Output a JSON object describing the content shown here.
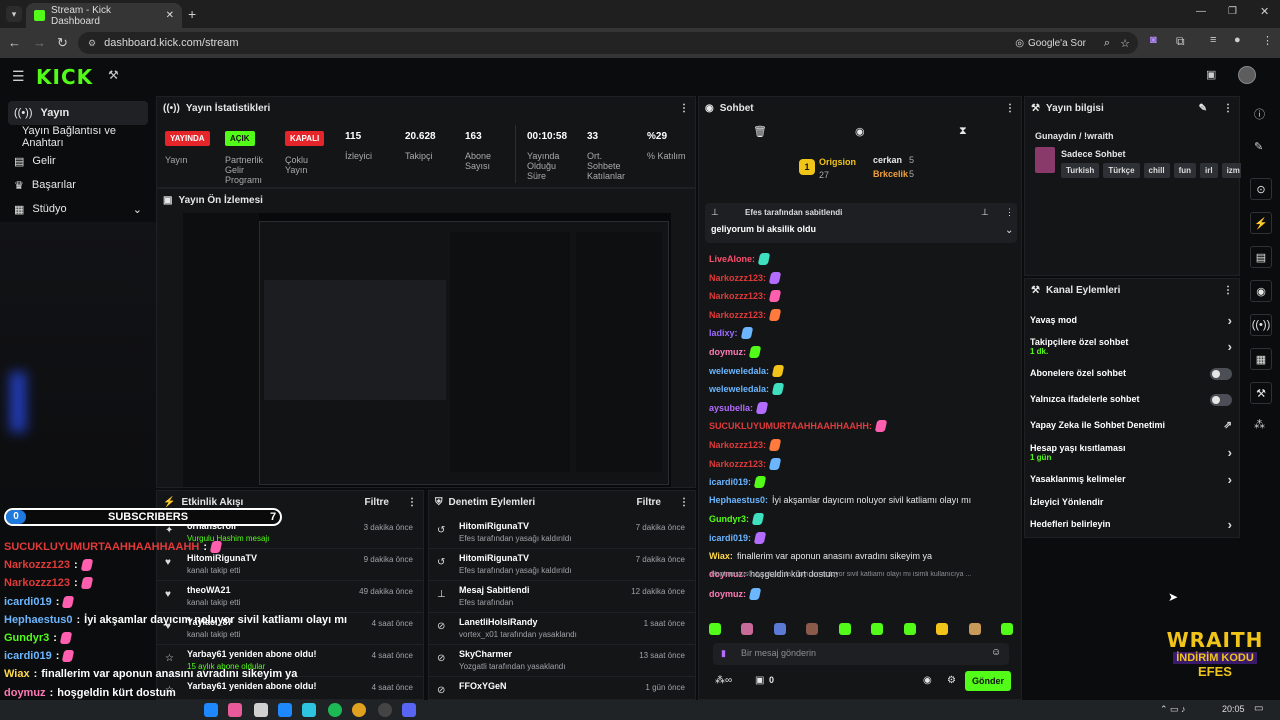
{
  "browser": {
    "tab_title": "Stream - Kick Dashboard",
    "url": "dashboard.kick.com/stream",
    "google_label": "Google'a Sor"
  },
  "sidebar": {
    "items": [
      {
        "label": "Yayın",
        "icon": "broadcast-icon"
      },
      {
        "label": "Yayın Bağlantısı ve Anahtarı",
        "icon": ""
      },
      {
        "label": "Gelir",
        "icon": "dollar-icon"
      },
      {
        "label": "Başarılar",
        "icon": "trophy-icon"
      },
      {
        "label": "Stüdyo",
        "icon": "studio-icon"
      }
    ]
  },
  "stats": {
    "title": "Yayın İstatistikleri",
    "items": [
      {
        "value": "YAYINDA",
        "label": "Yayın"
      },
      {
        "value": "AÇIK",
        "label": "Partnerlik Gelir Programı"
      },
      {
        "value": "KAPALI",
        "label": "Çoklu Yayın"
      },
      {
        "value": "115",
        "label": "İzleyici"
      },
      {
        "value": "20.628",
        "label": "Takipçi"
      },
      {
        "value": "163",
        "label": "Abone Sayısı"
      },
      {
        "value": "00:10:58",
        "label": "Yayında Olduğu Süre"
      },
      {
        "value": "33",
        "label": "Ort. Sohbete Katılanlar"
      },
      {
        "value": "%29",
        "label": "% Katılım"
      }
    ]
  },
  "preview": {
    "title": "Yayın Ön İzlemesi"
  },
  "activity": {
    "title": "Etkinlik Akışı",
    "filter": "Filtre",
    "rows": [
      {
        "title": "orhanscroll",
        "sub": "Vurgulu Hashim mesajı",
        "time": "3 dakika önce"
      },
      {
        "title": "HitomiRigunaTV",
        "sub": "kanalı takip etti",
        "time": "9 dakika önce"
      },
      {
        "title": "theoWA21",
        "sub": "kanalı takip etti",
        "time": "49 dakika önce"
      },
      {
        "title": "Yaylaci_87",
        "sub": "kanalı takip etti",
        "time": "4 saat önce"
      },
      {
        "title": "Yarbay61 yeniden abone oldu!",
        "sub": "15 aylık abone oldular",
        "time": "4 saat önce"
      },
      {
        "title": "Yarbay61 yeniden abone oldu!",
        "sub": "",
        "time": "4 saat önce"
      }
    ]
  },
  "moderation": {
    "title": "Denetim Eylemleri",
    "filter": "Filtre",
    "rows": [
      {
        "title": "HitomiRigunaTV",
        "sub": "Efes tarafından yasağı kaldırıldı",
        "time": "7 dakika önce"
      },
      {
        "title": "HitomiRigunaTV",
        "sub": "Efes tarafından yasağı kaldırıldı",
        "time": "7 dakika önce"
      },
      {
        "title": "Mesaj Sabitlendi",
        "sub": "Efes tarafından",
        "time": "12 dakika önce"
      },
      {
        "title": "LanetliHolsiRandy",
        "sub": "vortex_x01 tarafından yasaklandı",
        "time": "1 saat önce"
      },
      {
        "title": "SkyCharmer",
        "sub": "Yozgatli tarafından yasaklandı",
        "time": "13 saat önce"
      },
      {
        "title": "FFOxYGeN",
        "sub": "",
        "time": "1 gün önce"
      }
    ]
  },
  "chat": {
    "title": "Sohbet",
    "top": {
      "first": "Origsion",
      "first_count": "27",
      "second": "cerkan",
      "second_count": "5",
      "third": "Brkcelik",
      "third_count": "5"
    },
    "pinned_by": "Efes tarafından sabitlendi",
    "pinned_msg": "geliyorum bi aksilik oldu",
    "messages": [
      {
        "user": "LiveAlone:",
        "color": "#ff4d6d",
        "text": ""
      },
      {
        "user": "Narkozzz123:",
        "color": "#e03a3a",
        "text": ""
      },
      {
        "user": "Narkozzz123:",
        "color": "#e03a3a",
        "text": ""
      },
      {
        "user": "Narkozzz123:",
        "color": "#e03a3a",
        "text": ""
      },
      {
        "user": "ladixy:",
        "color": "#9b6bff",
        "text": ""
      },
      {
        "user": "doymuz:",
        "color": "#ff7ab6",
        "text": ""
      },
      {
        "user": "weleweledala:",
        "color": "#6bb6ff",
        "text": ""
      },
      {
        "user": "weleweledala:",
        "color": "#6bb6ff",
        "text": ""
      },
      {
        "user": "aysubella:",
        "color": "#b46bff",
        "text": ""
      },
      {
        "user": "SUCUKLUYUMURTAAHHAAHHAAHH:",
        "color": "#e03a3a",
        "text": ""
      },
      {
        "user": "Narkozzz123:",
        "color": "#e03a3a",
        "text": ""
      },
      {
        "user": "Narkozzz123:",
        "color": "#e03a3a",
        "text": ""
      },
      {
        "user": "icardi019:",
        "color": "#6bb6ff",
        "text": ""
      },
      {
        "user": "Hephaestus0:",
        "color": "#6bb6ff",
        "text": "İyi akşamlar dayıcım noluyor sivil katliamı olayı mı"
      },
      {
        "user": "Gundyr3:",
        "color": "#53fc18",
        "text": ""
      },
      {
        "user": "icardi019:",
        "color": "#6bb6ff",
        "text": ""
      },
      {
        "user": "Wiax:",
        "color": "#ffd84d",
        "text": "finallerim var aponun anasını avradını sikeyim ya"
      },
      {
        "user": "doymuz:",
        "color": "#ff7ab6",
        "text": "hoşgeldin kürt dostum"
      },
      {
        "user": "doymuz:",
        "color": "#ff7ab6",
        "text": ""
      }
    ],
    "reply_preview": "Hephaestus0: İyi akşamlar dayıcım noluyor sivil katliamı olayı mı isimli kullanıcıya ...",
    "input_placeholder": "Bir mesaj gönderin",
    "send_label": "Gönder",
    "points": "0"
  },
  "stream_info": {
    "title": "Yayın bilgisi",
    "stream_title": "Gunaydın / !wraith",
    "category": "Sadece Sohbet",
    "tags": [
      "Turkish",
      "Türkçe",
      "chill",
      "fun",
      "irl",
      "izm"
    ]
  },
  "channel_actions": {
    "title": "Kanal Eylemleri",
    "items": [
      {
        "label": "Yavaş mod",
        "sub": "",
        "control": "chevron"
      },
      {
        "label": "Takipçilere özel sohbet",
        "sub": "1 dk.",
        "control": "chevron"
      },
      {
        "label": "Abonelere özel sohbet",
        "sub": "",
        "control": "toggle"
      },
      {
        "label": "Yalnızca ifadelerle sohbet",
        "sub": "",
        "control": "toggle"
      },
      {
        "label": "Yapay Zeka ile Sohbet Denetimi",
        "sub": "",
        "control": "external"
      },
      {
        "label": "Hesap yaşı kısıtlaması",
        "sub": "1 gün",
        "control": "chevron"
      },
      {
        "label": "Yasaklanmış kelimeler",
        "sub": "",
        "control": "chevron"
      },
      {
        "label": "İzleyici Yönlendir",
        "sub": "",
        "control": "none"
      },
      {
        "label": "Hedefleri belirleyin",
        "sub": "",
        "control": "chevron"
      }
    ]
  },
  "overlay": {
    "sub_count_left": "0",
    "sub_label": "SUBSCRIBERS",
    "sub_count_right": "7",
    "lines": [
      {
        "user": "SUCUKLUYUMURTAAHHAAHHAAHH",
        "color": "#e03a3a",
        "text": ""
      },
      {
        "user": "Narkozzz123",
        "color": "#e03a3a",
        "text": ""
      },
      {
        "user": "Narkozzz123",
        "color": "#e03a3a",
        "text": ""
      },
      {
        "user": "icardi019",
        "color": "#6bb6ff",
        "text": ""
      },
      {
        "user": "Hephaestus0",
        "color": "#6bb6ff",
        "text": "İyi akşamlar dayıcım noluyor sivil katliamı olayı mı"
      },
      {
        "user": "Gundyr3",
        "color": "#53fc18",
        "text": ""
      },
      {
        "user": "icardi019",
        "color": "#6bb6ff",
        "text": ""
      },
      {
        "user": "Wiax",
        "color": "#ffd84d",
        "text": "finallerim var aponun anasını avradını sikeyim ya"
      },
      {
        "user": "doymuz",
        "color": "#ff7ab6",
        "text": "hoşgeldin kürt dostum"
      }
    ],
    "promo_line1": "WRAITH",
    "promo_line2": "İNDİRİM KODU",
    "promo_line3": "EFES"
  },
  "taskbar": {
    "time": "20:05"
  },
  "colors": {
    "accent": "#53fc18",
    "live": "#e5252a",
    "panel": "#141517"
  }
}
